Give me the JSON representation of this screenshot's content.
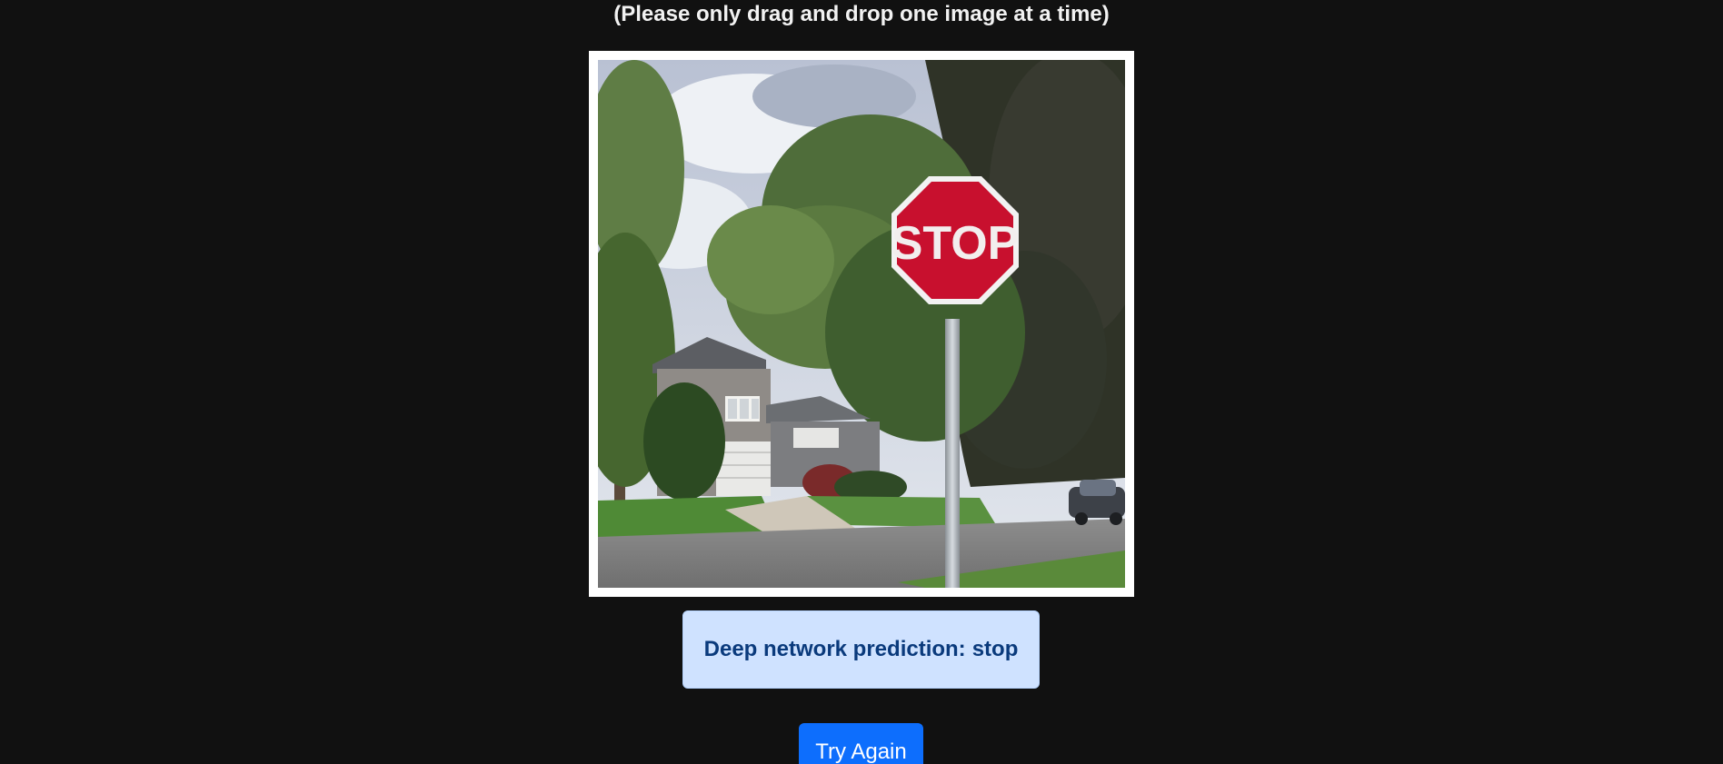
{
  "instruction": "(Please only drag and drop one image at a time)",
  "dropzone": {
    "image_subject": "stop-sign-photo",
    "sign_text": "STOP"
  },
  "prediction": {
    "label": "Deep network prediction:",
    "value": "stop"
  },
  "actions": {
    "try_again_label": "Try Again"
  },
  "colors": {
    "background": "#111111",
    "prediction_bg": "#cfe2ff",
    "prediction_text": "#0a3a7c",
    "button_bg": "#0d6efd",
    "stop_red": "#c8102e"
  }
}
